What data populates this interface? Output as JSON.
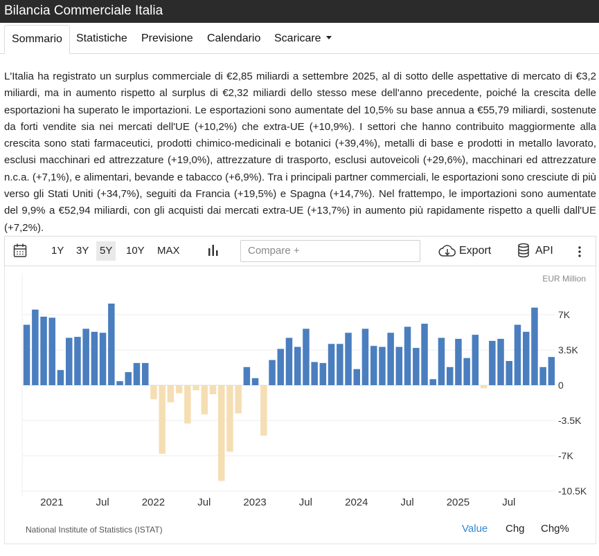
{
  "header": {
    "title": "Bilancia Commerciale Italia"
  },
  "tabs": [
    {
      "label": "Sommario",
      "active": true
    },
    {
      "label": "Statistiche"
    },
    {
      "label": "Previsione"
    },
    {
      "label": "Calendario"
    },
    {
      "label": "Scaricare"
    }
  ],
  "summary": "L'Italia ha registrato un surplus commerciale di €2,85 miliardi a settembre 2025, al di sotto delle aspettative di mercato di €3,2 miliardi, ma in aumento rispetto al surplus di €2,32 miliardi dello stesso mese dell'anno precedente, poiché la crescita delle esportazioni ha superato le importazioni. Le esportazioni sono aumentate del 10,5% su base annua a €55,79 miliardi, sostenute da forti vendite sia nei mercati dell'UE (+10,2%) che extra-UE (+10,9%). I settori che hanno contribuito maggiormente alla crescita sono stati farmaceutici, prodotti chimico-medicinali e botanici (+39,4%), metalli di base e prodotti in metallo lavorato, esclusi macchinari ed attrezzature (+19,0%), attrezzature di trasporto, esclusi autoveicoli (+29,6%), macchinari ed attrezzature n.c.a. (+7,1%), e alimentari, bevande e tabacco (+6,9%). Tra i principali partner commerciali, le esportazioni sono cresciute di più verso gli Stati Uniti (+34,7%), seguiti da Francia (+19,5%) e Spagna (+14,7%). Nel frattempo, le importazioni sono aumentate del 9,9% a €52,94 miliardi, con gli acquisti dai mercati extra-UE (+13,7%) in aumento più rapidamente rispetto a quelli dall'UE (+7,2%).",
  "toolbar": {
    "ranges": [
      "1Y",
      "3Y",
      "5Y",
      "10Y",
      "MAX"
    ],
    "active_range": "5Y",
    "compare_placeholder": "Compare +",
    "export_label": "Export",
    "api_label": "API"
  },
  "chart_data": {
    "type": "bar",
    "unit_label": "EUR Million",
    "x_labels": [
      "2021",
      "Jul",
      "2022",
      "Jul",
      "2023",
      "Jul",
      "2024",
      "Jul",
      "2025",
      "Jul"
    ],
    "y_ticks": [
      "7K",
      "3.5K",
      "0",
      "-3.5K",
      "-7K",
      "-10.5K"
    ],
    "ylim": [
      -10500,
      7000
    ],
    "positive_color": "#4a7ebf",
    "negative_color": "#f5deb3",
    "values": [
      6000,
      7500,
      6800,
      6700,
      1500,
      4700,
      4800,
      5600,
      5300,
      5200,
      8100,
      400,
      1300,
      2200,
      2200,
      -1400,
      -6800,
      -1700,
      -800,
      -3800,
      -500,
      -2900,
      -900,
      -9500,
      -6600,
      -2800,
      1800,
      700,
      -5000,
      2500,
      3600,
      4700,
      3800,
      5600,
      2300,
      2200,
      4100,
      4100,
      5200,
      1600,
      5600,
      3900,
      3800,
      5200,
      3800,
      5800,
      3700,
      6100,
      600,
      4700,
      1800,
      4600,
      2700,
      5000,
      -300,
      4400,
      4600,
      2400,
      6000,
      5300,
      7700,
      1800,
      2800
    ]
  },
  "footer": {
    "source": "National Institute of Statistics (ISTAT)",
    "tabs": [
      "Value",
      "Chg",
      "Chg%"
    ],
    "active": "Value"
  }
}
